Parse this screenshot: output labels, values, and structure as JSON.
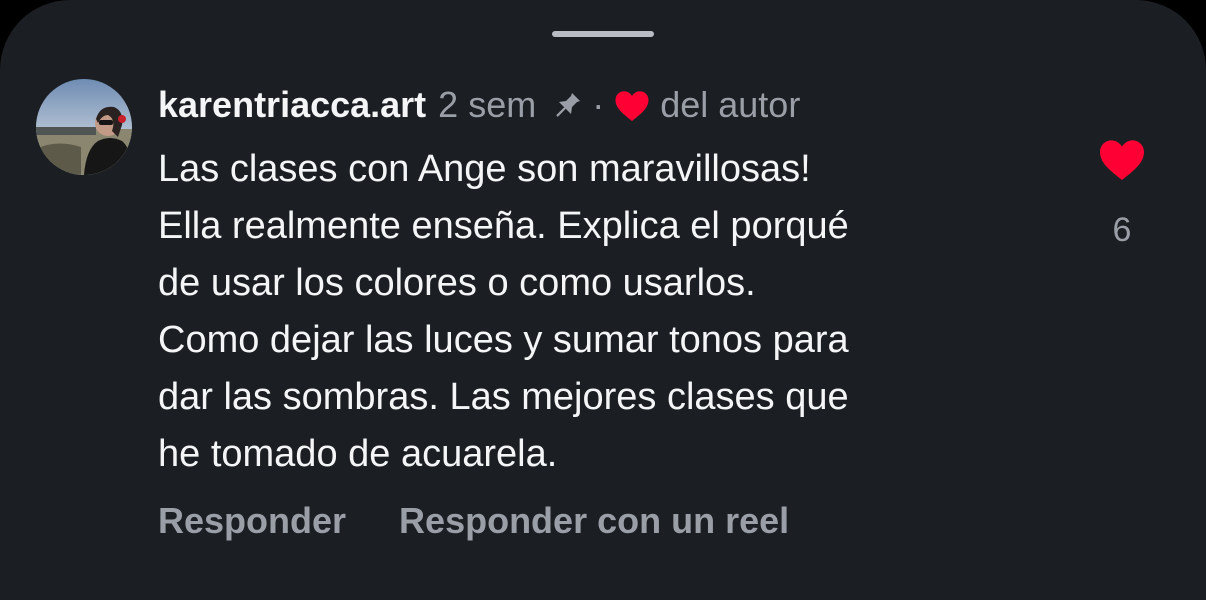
{
  "comment": {
    "username": "karentriacca.art",
    "time_ago": "2 sem",
    "separator": "·",
    "author_liked_label": "del autor",
    "text": "Las clases con Ange son maravillosas!\nElla realmente enseña. Explica el porqué\nde usar los colores o como usarlos.\nComo dejar las luces y sumar tonos para\ndar las sombras. Las mejores clases que\nhe tomado de acuarela.",
    "like_count": "6",
    "icons": {
      "pinned": "pin-icon",
      "author_like": "heart-filled-icon",
      "like": "heart-filled-icon"
    }
  },
  "actions": {
    "reply_label": "Responder",
    "reply_with_reel_label": "Responder con un reel"
  },
  "colors": {
    "background": "#1b1e22",
    "primary_text": "#f3f5f7",
    "secondary_text": "#9a9fa7",
    "like_red": "#ff0034"
  }
}
